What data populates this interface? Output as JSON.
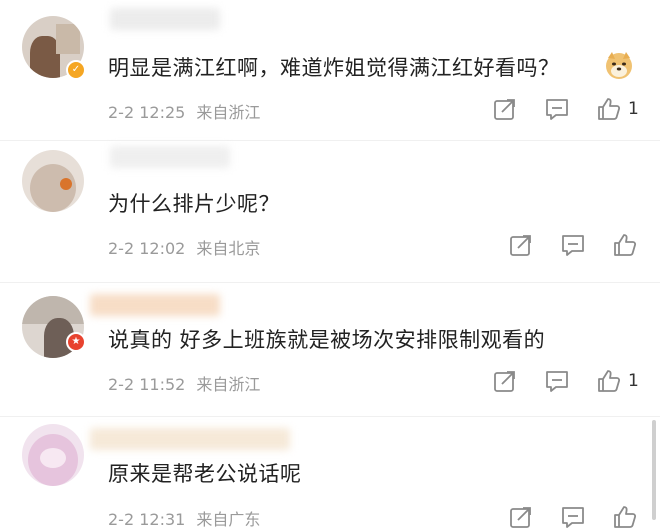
{
  "icons": {
    "share": "share-icon",
    "reply": "comment-icon",
    "like": "thumbs-up-icon",
    "verified": "verified-badge-icon",
    "emoji": "doge-emoji-icon"
  },
  "colors": {
    "text": "#222222",
    "meta": "#9a9a9a",
    "icon": "#8a8a8a",
    "verified_badge": "#f5a623",
    "vip_badge": "#e8432f"
  },
  "comments": [
    {
      "text": "明显是满江红啊，难道炸姐觉得满江红好看吗？",
      "time": "2-2 12:25",
      "location": "来自浙江",
      "likes": "1"
    },
    {
      "text": "为什么排片少呢？",
      "time": "2-2 12:02",
      "location": "来自北京",
      "likes": ""
    },
    {
      "text": "说真的 好多上班族就是被场次安排限制观看的",
      "time": "2-2 11:52",
      "location": "来自浙江",
      "likes": "1"
    },
    {
      "text": "原来是帮老公说话呢",
      "time": "2-2 12:31",
      "location": "来自广东",
      "likes": ""
    }
  ]
}
